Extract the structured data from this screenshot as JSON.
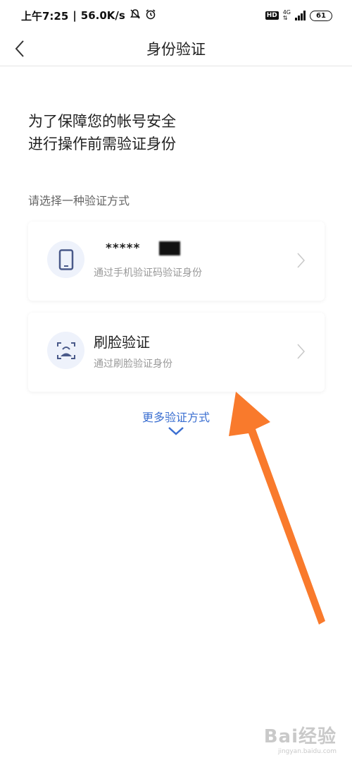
{
  "status_bar": {
    "time": "上午7:25",
    "speed": "56.0K/s",
    "hd": "HD",
    "network": "4G",
    "battery": "61"
  },
  "nav": {
    "title": "身份验证"
  },
  "intro": {
    "line1": "为了保障您的帐号安全",
    "line2": "进行操作前需验证身份"
  },
  "section_label": "请选择一种验证方式",
  "options": [
    {
      "title": "*****",
      "desc": "通过手机验证码验证身份",
      "icon": "phone-icon"
    },
    {
      "title": "刷脸验证",
      "desc": "通过刷脸验证身份",
      "icon": "face-scan-icon"
    }
  ],
  "more_methods": {
    "label": "更多验证方式"
  },
  "colors": {
    "accent": "#3b6fd1",
    "annotation": "#f97a2c",
    "icon_bg": "#eef2fb",
    "icon_fg": "#4a5a8a"
  },
  "watermark": {
    "logo": "Bai经验",
    "url": "jingyan.baidu.com"
  }
}
